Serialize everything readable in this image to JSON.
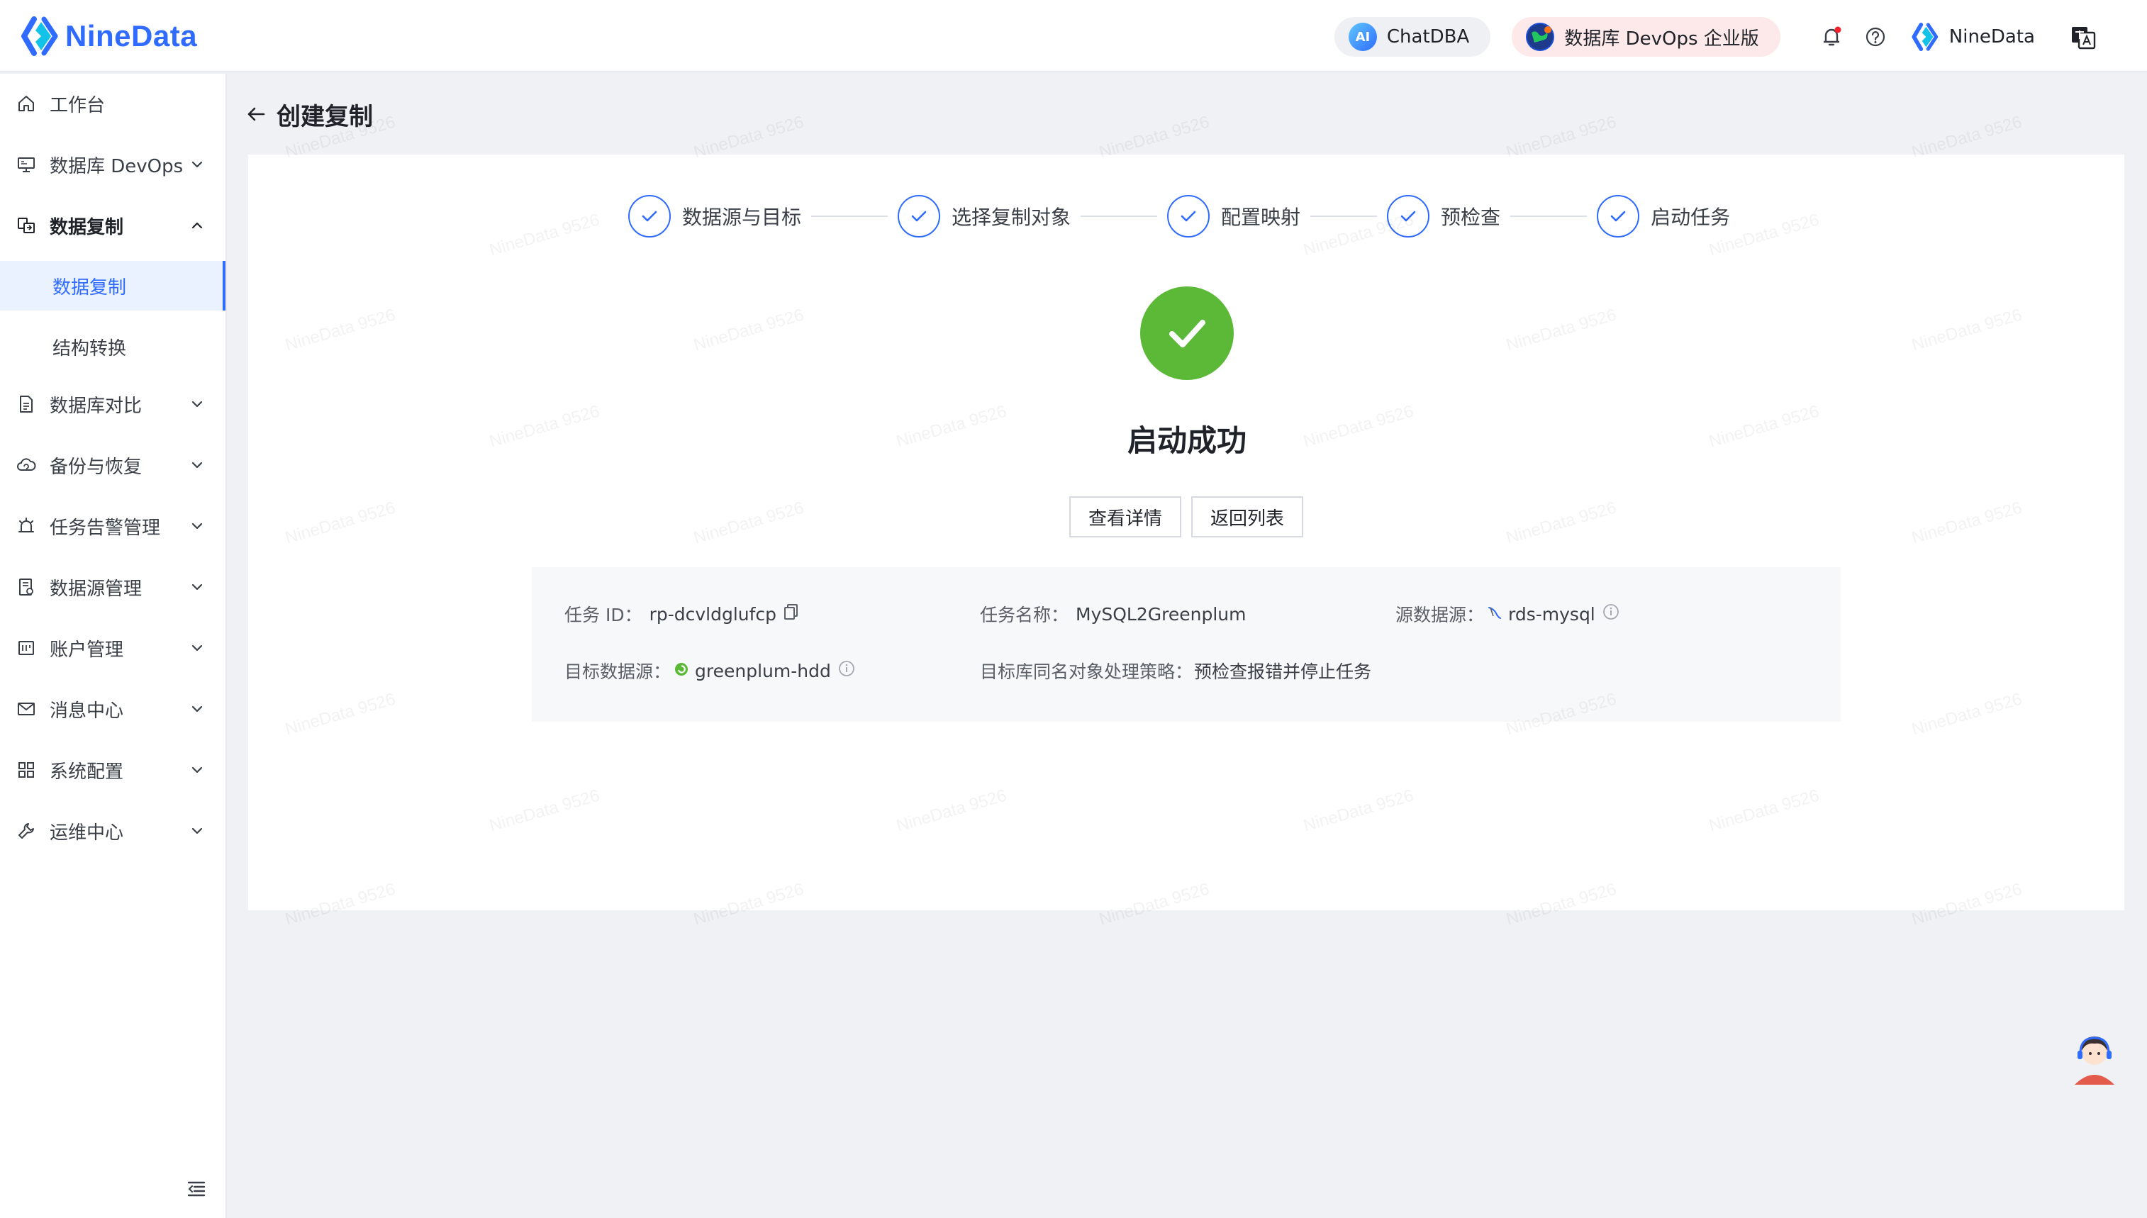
{
  "app": {
    "logo_text": "NineData"
  },
  "header": {
    "chatdba_label": "ChatDBA",
    "chatdba_icon_text": "AI",
    "devops_label": "数据库 DevOps 企业版",
    "user_name": "NineData"
  },
  "sidebar": {
    "items": [
      {
        "label": "工作台",
        "icon": "home-icon"
      },
      {
        "label": "数据库 DevOps",
        "icon": "monitor-icon"
      },
      {
        "label": "数据复制",
        "icon": "replicate-icon"
      },
      {
        "label": "数据库对比",
        "icon": "compare-icon"
      },
      {
        "label": "备份与恢复",
        "icon": "cloud-backup-icon"
      },
      {
        "label": "任务告警管理",
        "icon": "alarm-icon"
      },
      {
        "label": "数据源管理",
        "icon": "datasource-icon"
      },
      {
        "label": "账户管理",
        "icon": "account-icon"
      },
      {
        "label": "消息中心",
        "icon": "mail-icon"
      },
      {
        "label": "系统配置",
        "icon": "grid-icon"
      },
      {
        "label": "运维中心",
        "icon": "wrench-icon"
      }
    ],
    "sub_items": [
      {
        "label": "数据复制"
      },
      {
        "label": "结构转换"
      }
    ]
  },
  "page": {
    "title": "创建复制"
  },
  "steps": [
    {
      "label": "数据源与目标"
    },
    {
      "label": "选择复制对象"
    },
    {
      "label": "配置映射"
    },
    {
      "label": "预检查"
    },
    {
      "label": "启动任务"
    }
  ],
  "result": {
    "title": "启动成功",
    "detail_button": "查看详情",
    "back_button": "返回列表"
  },
  "task_info": {
    "task_id_label": "任务 ID：",
    "task_id": "rp-dcvldglufcp",
    "task_name_label": "任务名称：",
    "task_name": "MySQL2Greenplum",
    "source_label": "源数据源：",
    "source": "rds-mysql",
    "target_label": "目标数据源：",
    "target": "greenplum-hdd",
    "policy_label": "目标库同名对象处理策略：",
    "policy": "预检查报错并停止任务"
  },
  "watermark_text": "NineData 9526",
  "colors": {
    "primary": "#2f6bff",
    "success": "#5cb938"
  }
}
